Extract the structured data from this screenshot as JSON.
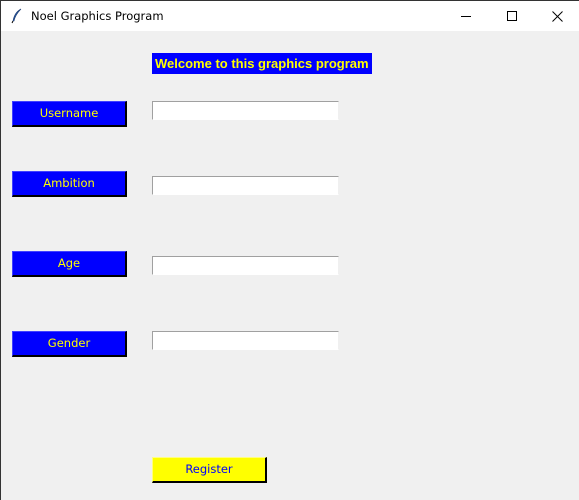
{
  "window": {
    "title": "Noel Graphics Program",
    "icon": "feather-icon",
    "controls": {
      "minimize": "minimize-icon",
      "maximize": "maximize-icon",
      "close": "close-icon"
    }
  },
  "header": {
    "welcome_text": "Welcome to this graphics program"
  },
  "form": {
    "fields": [
      {
        "label": "Username",
        "value": ""
      },
      {
        "label": "Ambition",
        "value": ""
      },
      {
        "label": "Age",
        "value": ""
      },
      {
        "label": "Gender",
        "value": ""
      }
    ],
    "register_label": "Register"
  },
  "colors": {
    "label_bg": "#0000ff",
    "label_fg": "#ffff00",
    "register_bg": "#ffff00",
    "register_fg": "#0000ff",
    "window_bg": "#f0f0f0"
  }
}
